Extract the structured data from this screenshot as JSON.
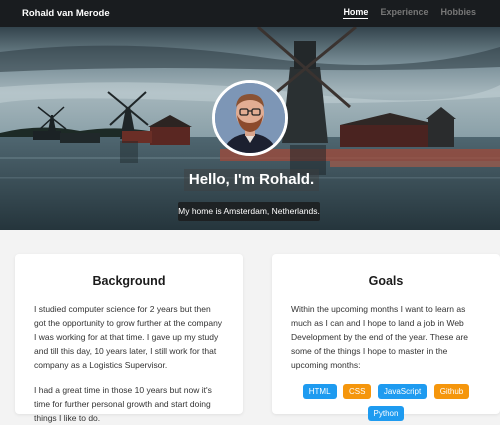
{
  "nav": {
    "brand": "Rohald van Merode",
    "links": [
      {
        "label": "Home",
        "active": true
      },
      {
        "label": "Experience",
        "active": false
      },
      {
        "label": "Hobbies",
        "active": false
      }
    ]
  },
  "hero": {
    "title": "Hello, I'm Rohald.",
    "subtitle": "My home is Amsterdam, Netherlands."
  },
  "background": {
    "title": "Background",
    "paragraphs": [
      "I studied computer science for 2 years but then got the opportunity to grow further at the company I was working for at that time. I gave up my study and till this day, 10 years later, I still work for that company as a Logistics Supervisor.",
      "I had a great time in those 10 years but now it's time for further personal growth and start doing things I like to do."
    ]
  },
  "goals": {
    "title": "Goals",
    "paragraph": "Within the upcoming months I want to learn as much as I can and I hope to land a job in Web Development by the end of the year. These are some of the things I hope to master in the upcoming months:",
    "tags": [
      {
        "label": "HTML",
        "color": "#1e9bf0"
      },
      {
        "label": "CSS",
        "color": "#f5960c"
      },
      {
        "label": "JavaScript",
        "color": "#1e9bf0"
      },
      {
        "label": "Github",
        "color": "#f5960c"
      },
      {
        "label": "Python",
        "color": "#1e9bf0"
      }
    ]
  }
}
